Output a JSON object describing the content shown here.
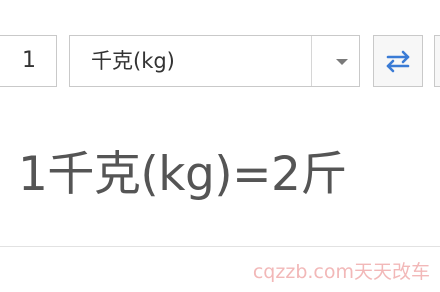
{
  "converter": {
    "quantity": "1",
    "unit_selected": "千克(kg)",
    "result": "1千克(kg)=2斤"
  },
  "watermark": {
    "text": "cqzzb.com天天改车"
  },
  "colors": {
    "border": "#c9c9c9",
    "text": "#333333",
    "result_text": "#555555",
    "swap_icon": "#3a7bd5",
    "watermark": "#f2b8b8"
  },
  "icons": {
    "dropdown": "chevron-down-icon",
    "swap": "swap-arrows-icon"
  }
}
